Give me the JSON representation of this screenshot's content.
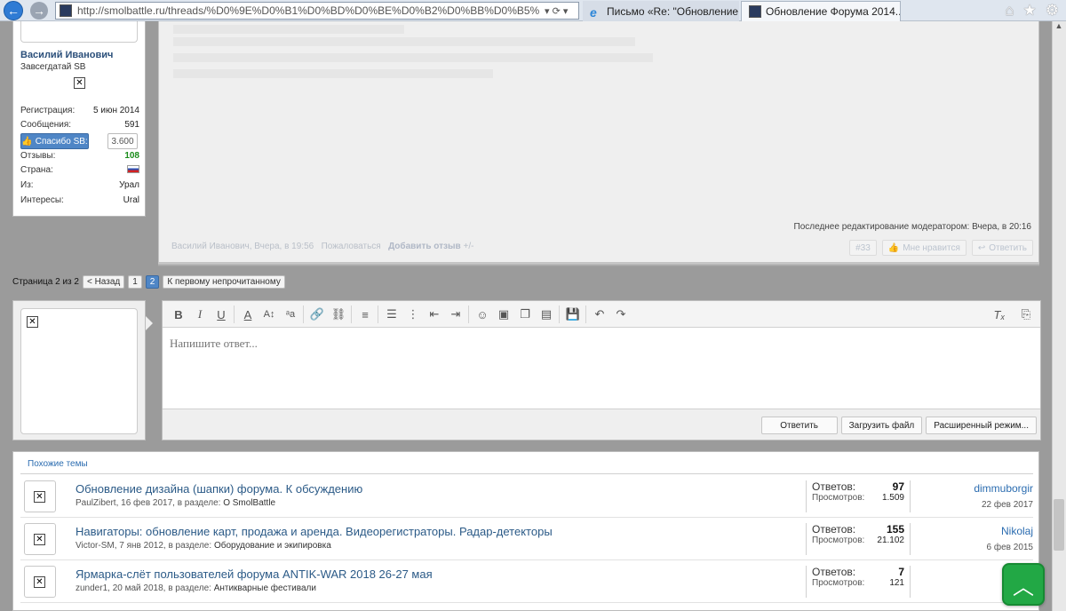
{
  "browser": {
    "url": "http://smolbattle.ru/threads/%D0%9E%D0%B1%D0%BD%D0%BE%D0%B2%D0%BB%D0%B5%D0%BD%D0%B8%D0%B5%D0%",
    "addr_controls": "▾ ⟳ ▾",
    "tabs": [
      {
        "label": "Письмо «Re: \"Обновление Ф...",
        "active": false
      },
      {
        "label": "Обновление Форума 2014...",
        "active": true
      }
    ]
  },
  "user": {
    "name": "Василий Иванович",
    "title": "Завсегдатай SB",
    "stats": [
      {
        "label": "Регистрация:",
        "value": "5 июн 2014"
      },
      {
        "label": "Сообщения:",
        "value": "591"
      }
    ],
    "thanks_label": "Спасибо SB:",
    "thanks_count": "3.600",
    "stats2": [
      {
        "label": "Отзывы:",
        "value": "108"
      },
      {
        "label": "Страна:",
        "value": ""
      },
      {
        "label": "Из:",
        "value": "Урал"
      },
      {
        "label": "Интересы:",
        "value": "Ural"
      }
    ]
  },
  "post": {
    "edit_note": "Последнее редактирование модератором: Вчера, в 20:16",
    "meta": {
      "author_time": "Василий Иванович, Вчера, в 19:56",
      "report": "Пожаловаться",
      "add_review": "Добавить отзыв",
      "plus_minus": "+/-"
    },
    "number": "#33",
    "dislike": "Мне нравится",
    "reply": "Ответить"
  },
  "pager": {
    "info": "Страница 2 из 2",
    "prev": "< Назад",
    "pages": [
      "1",
      "2"
    ],
    "active_page": "2",
    "first_unread": "К первому непрочитанному"
  },
  "editor": {
    "placeholder": "Напишите ответ...",
    "reply_btn": "Ответить",
    "upload_btn": "Загрузить файл",
    "advanced_btn": "Расширенный режим..."
  },
  "similar": {
    "heading": "Похожие темы",
    "threads": [
      {
        "title": "Обновление дизайна (шапки) форума. К обсуждению",
        "author_date": "PaulZibert, 16 фев 2017, в разделе: ",
        "section": "О SmolBattle",
        "replies_label": "Ответов:",
        "replies": "97",
        "views_label": "Просмотров:",
        "views": "1.509",
        "last_user": "dimmuborgir",
        "last_date": "22 фев 2017"
      },
      {
        "title": "Навигаторы: обновление карт, продажа и аренда. Видеорегистраторы. Радар-детекторы",
        "author_date": "Victor-SM, 7 янв 2012, в разделе: ",
        "section": "Оборудование и экипировка",
        "replies_label": "Ответов:",
        "replies": "155",
        "views_label": "Просмотров:",
        "views": "21.102",
        "last_user": "Nikolaj",
        "last_date": "6 фев 2015"
      },
      {
        "title": "Ярмарка-слёт пользователей форума ANTIK-WAR 2018 26-27 мая",
        "author_date": "zunder1, 20 май 2018, в разделе: ",
        "section": "Антикварные фестивали",
        "replies_label": "Ответов:",
        "replies": "7",
        "views_label": "Просмотров:",
        "views": "121",
        "last_user": "zun",
        "last_date": "28 м"
      }
    ]
  },
  "colors": {
    "accent": "#4f86c6",
    "link": "#2b5a87",
    "to_top": "#22a845"
  }
}
